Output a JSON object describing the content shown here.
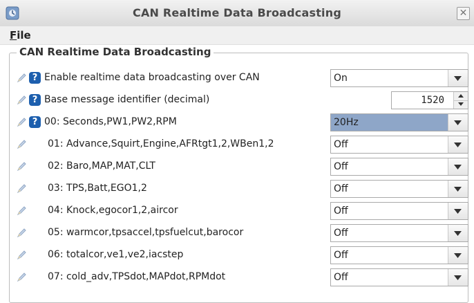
{
  "window": {
    "title": "CAN Realtime Data Broadcasting",
    "close_glyph": "✕"
  },
  "menu": {
    "file_mnemonic": "F",
    "file_rest": "ile"
  },
  "panel": {
    "legend": "CAN Realtime Data Broadcasting"
  },
  "rows": [
    {
      "label": "Enable realtime data broadcasting over CAN",
      "control": "combo",
      "value": "On",
      "help": true
    },
    {
      "label": "Base message identifier (decimal)",
      "control": "spinner",
      "value": "1520",
      "help": true
    },
    {
      "label": "00: Seconds,PW1,PW2,RPM",
      "control": "combo",
      "value": "20Hz",
      "help": true,
      "highlighted": true
    },
    {
      "label": "01: Advance,Squirt,Engine,AFRtgt1,2,WBen1,2",
      "control": "combo",
      "value": "Off",
      "help": false
    },
    {
      "label": "02: Baro,MAP,MAT,CLT",
      "control": "combo",
      "value": "Off",
      "help": false
    },
    {
      "label": "03: TPS,Batt,EGO1,2",
      "control": "combo",
      "value": "Off",
      "help": false
    },
    {
      "label": "04: Knock,egocor1,2,aircor",
      "control": "combo",
      "value": "Off",
      "help": false
    },
    {
      "label": "05: warmcor,tpsaccel,tpsfuelcut,barocor",
      "control": "combo",
      "value": "Off",
      "help": false
    },
    {
      "label": "06: totalcor,ve1,ve2,iacstep",
      "control": "combo",
      "value": "Off",
      "help": false
    },
    {
      "label": "07: cold_adv,TPSdot,MAPdot,RPMdot",
      "control": "combo",
      "value": "Off",
      "help": false
    }
  ],
  "icons": {
    "app": "app-icon",
    "close": "close-icon",
    "help": "help-icon",
    "pencil": "pencil-icon",
    "dropdown": "chevron-down-icon"
  },
  "colors": {
    "help_badge": "#1d5fae",
    "highlight": "#8ea6c8"
  }
}
